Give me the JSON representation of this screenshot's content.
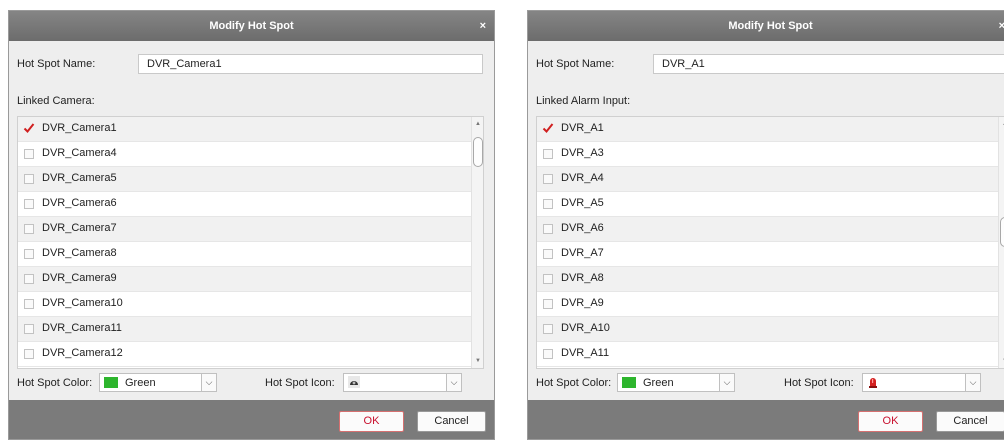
{
  "dialogs": [
    {
      "title": "Modify Hot Spot",
      "close_label": "×",
      "name_label": "Hot Spot Name:",
      "name_value": "DVR_Camera1",
      "linked_label": "Linked Camera:",
      "items": [
        {
          "label": "DVR_Camera1",
          "checked": true
        },
        {
          "label": "DVR_Camera4",
          "checked": false
        },
        {
          "label": "DVR_Camera5",
          "checked": false
        },
        {
          "label": "DVR_Camera6",
          "checked": false
        },
        {
          "label": "DVR_Camera7",
          "checked": false
        },
        {
          "label": "DVR_Camera8",
          "checked": false
        },
        {
          "label": "DVR_Camera9",
          "checked": false
        },
        {
          "label": "DVR_Camera10",
          "checked": false
        },
        {
          "label": "DVR_Camera11",
          "checked": false
        },
        {
          "label": "DVR_Camera12",
          "checked": false
        }
      ],
      "color_label": "Hot Spot Color:",
      "color_value": "Green",
      "color_hex": "#2db52d",
      "icon_label": "Hot Spot Icon:",
      "icon_name": "camera-dome-icon",
      "ok_label": "OK",
      "cancel_label": "Cancel"
    },
    {
      "title": "Modify Hot Spot",
      "close_label": "×",
      "name_label": "Hot Spot Name:",
      "name_value": "DVR_A1",
      "linked_label": "Linked Alarm Input:",
      "items": [
        {
          "label": "DVR_A1",
          "checked": true
        },
        {
          "label": "DVR_A3",
          "checked": false
        },
        {
          "label": "DVR_A4",
          "checked": false
        },
        {
          "label": "DVR_A5",
          "checked": false
        },
        {
          "label": "DVR_A6",
          "checked": false
        },
        {
          "label": "DVR_A7",
          "checked": false
        },
        {
          "label": "DVR_A8",
          "checked": false
        },
        {
          "label": "DVR_A9",
          "checked": false
        },
        {
          "label": "DVR_A10",
          "checked": false
        },
        {
          "label": "DVR_A11",
          "checked": false
        }
      ],
      "color_label": "Hot Spot Color:",
      "color_value": "Green",
      "color_hex": "#2db52d",
      "icon_label": "Hot Spot Icon:",
      "icon_name": "alarm-siren-icon",
      "ok_label": "OK",
      "cancel_label": "Cancel"
    }
  ]
}
